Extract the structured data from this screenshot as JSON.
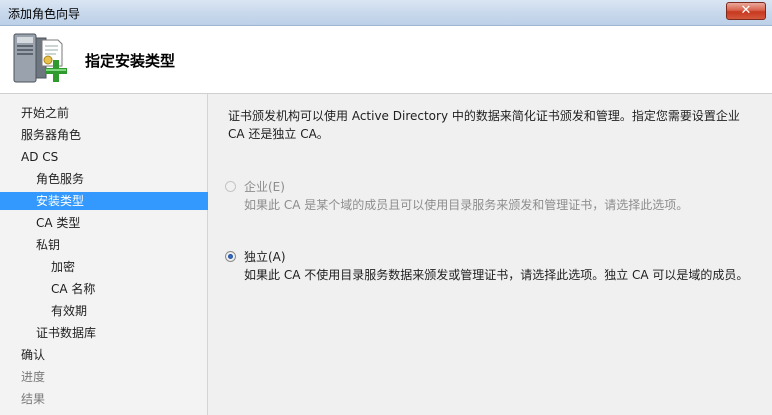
{
  "window": {
    "title": "添加角色向导",
    "close_glyph": "✕"
  },
  "header": {
    "title": "指定安装类型",
    "icon": "server-add-icon"
  },
  "sidebar": {
    "items": [
      {
        "label": "开始之前",
        "level": 1,
        "state": "normal"
      },
      {
        "label": "服务器角色",
        "level": 1,
        "state": "normal"
      },
      {
        "label": "AD CS",
        "level": 1,
        "state": "normal"
      },
      {
        "label": "角色服务",
        "level": 2,
        "state": "normal"
      },
      {
        "label": "安装类型",
        "level": 2,
        "state": "active"
      },
      {
        "label": "CA 类型",
        "level": 2,
        "state": "normal"
      },
      {
        "label": "私钥",
        "level": 2,
        "state": "normal"
      },
      {
        "label": "加密",
        "level": 3,
        "state": "normal"
      },
      {
        "label": "CA 名称",
        "level": 3,
        "state": "normal"
      },
      {
        "label": "有效期",
        "level": 3,
        "state": "normal"
      },
      {
        "label": "证书数据库",
        "level": 2,
        "state": "normal"
      },
      {
        "label": "确认",
        "level": 1,
        "state": "normal"
      },
      {
        "label": "进度",
        "level": 1,
        "state": "disabled"
      },
      {
        "label": "结果",
        "level": 1,
        "state": "disabled"
      }
    ]
  },
  "main": {
    "intro": "证书颁发机构可以使用 Active Directory 中的数据来简化证书颁发和管理。指定您需要设置企业 CA 还是独立 CA。",
    "options": [
      {
        "label": "企业(E)",
        "description": "如果此 CA 是某个域的成员且可以使用目录服务来颁发和管理证书，请选择此选项。",
        "checked": false,
        "enabled": false
      },
      {
        "label": "独立(A)",
        "description": "如果此 CA 不使用目录服务数据来颁发或管理证书，请选择此选项。独立 CA 可以是域的成员。",
        "checked": true,
        "enabled": true
      }
    ]
  },
  "colors": {
    "selection": "#3399ff",
    "disabled_text": "#8d8d8d"
  }
}
